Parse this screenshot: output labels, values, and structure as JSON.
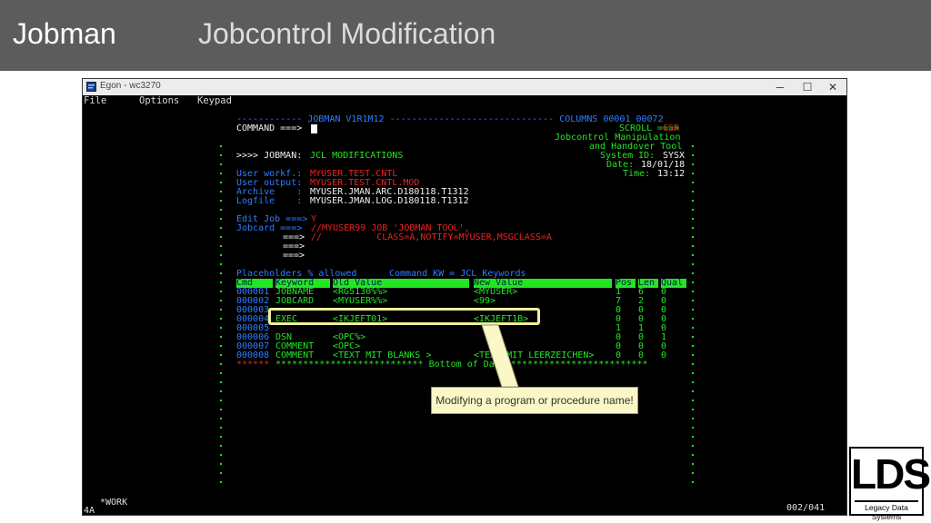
{
  "slide": {
    "brand": "Jobman",
    "title": "Jobcontrol Modification"
  },
  "window": {
    "title": "Egon - wc3270",
    "minimize": "─",
    "maximize": "☐",
    "close": "✕"
  },
  "menu": [
    "File",
    "Options",
    "Keypad"
  ],
  "screen": {
    "banner": "------------ JOBMAN V1R1M12 ------------------------------ COLUMNS 00001 00072",
    "command_label": "COMMAND ===>",
    "scroll_label": "SCROLL ===>",
    "scroll_value": "CSR",
    "tool_line1": "Jobcontrol Manipulation",
    "tool_line2": "and Handover Tool",
    "sysid_label": "System ID:",
    "sysid_value": "SYSX",
    "date_label": "Date:",
    "date_value": "18/01/18",
    "time_label": "Time:",
    "time_value": "13:12",
    "function_label": ">>>> JOBMAN:",
    "function_value": "JCL MODIFICATIONS",
    "fields": [
      {
        "label": "User workf.:",
        "value": "MYUSER.TEST.CNTL",
        "kind": "input"
      },
      {
        "label": "User output:",
        "value": "MYUSER.TEST.CNTL.MOD",
        "kind": "input"
      },
      {
        "label": "Archive    :",
        "value": "MYUSER.JMAN.ARC.D180118.T1312",
        "kind": "output"
      },
      {
        "label": "Logfile    :",
        "value": "MYUSER.JMAN.LOG.D180118.T1312",
        "kind": "output"
      }
    ],
    "edit_label": "Edit Job ===>",
    "edit_value": "Y",
    "jobcard_label": "Jobcard ===>",
    "jobcard_lines": [
      "//MYUSER99 JOB 'JOBMAN TOOL',",
      "//          CLASS=A,NOTIFY=MYUSER,MSGCLASS=A",
      "",
      ""
    ],
    "arrow": "===>",
    "placeholders": "Placeholders % allowed",
    "command_kw": "Command KW = JCL Keywords",
    "columns": [
      "Cmd",
      "Keyword",
      "Old Value",
      "New Value",
      "Pos",
      "Len",
      "Qual"
    ],
    "rows": [
      {
        "num": "000001",
        "kw": "JOBNAME",
        "old": "<RG5130%%>",
        "new": "<MYUSER>",
        "pos": "1",
        "len": "6",
        "qual": "0"
      },
      {
        "num": "000002",
        "kw": "JOBCARD",
        "old": "<MYUSER%%>",
        "new": "<99>",
        "pos": "7",
        "len": "2",
        "qual": "0"
      },
      {
        "num": "000003",
        "kw": "",
        "old": "",
        "new": "",
        "pos": "0",
        "len": "0",
        "qual": "0"
      },
      {
        "num": "000004",
        "kw": "EXEC",
        "old": "<IKJEFT01>",
        "new": "<IKJEFT1B>",
        "pos": "0",
        "len": "0",
        "qual": "0"
      },
      {
        "num": "000005",
        "kw": "",
        "old": "",
        "new": "",
        "pos": "1",
        "len": "1",
        "qual": "0"
      },
      {
        "num": "000006",
        "kw": "DSN",
        "old": "<OPC%>",
        "new": "",
        "pos": "0",
        "len": "0",
        "qual": "1"
      },
      {
        "num": "000007",
        "kw": "COMMENT",
        "old": "<OPC>",
        "new": "",
        "pos": "0",
        "len": "0",
        "qual": "0"
      },
      {
        "num": "000008",
        "kw": "COMMENT",
        "old": "<TEXT MIT BLANKS >",
        "new": "<TEXT MIT LEERZEICHEN>",
        "pos": "0",
        "len": "0",
        "qual": "0"
      }
    ],
    "bottom_stars": "******",
    "bottom_text": "*************************** Bottom of Data *************************"
  },
  "status": {
    "work": "*WORK",
    "mode": "4A",
    "position": "002/041"
  },
  "callout": "Modifying a program or procedure name!",
  "logo": {
    "mark": "LDS",
    "name": "Legacy Data Systems"
  },
  "colors": {
    "green": "#22e622",
    "blue": "#2f7dff",
    "red": "#ee2020",
    "header_bar": "#5c5c5c",
    "callout_bg": "#fbf7c6"
  }
}
